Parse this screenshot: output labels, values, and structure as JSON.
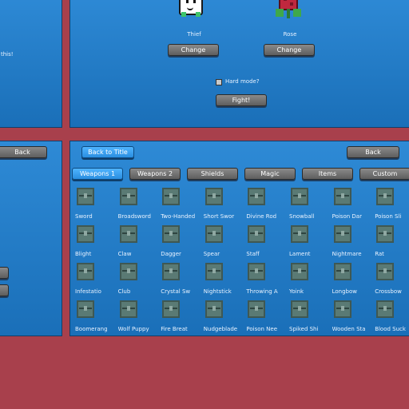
{
  "top_left_panel": {
    "text": "this!"
  },
  "character_select": {
    "characters": [
      {
        "name": "Thief",
        "change_label": "Change"
      },
      {
        "name": "Rose",
        "change_label": "Change"
      }
    ],
    "hard_mode_label": "Hard mode?",
    "hard_mode_checked": false,
    "fight_label": "Fight!"
  },
  "left_panel": {
    "back_label": "Back"
  },
  "item_browser": {
    "back_to_title_label": "Back to Title",
    "back_label": "Back",
    "tabs": [
      {
        "label": "Weapons 1",
        "active": true
      },
      {
        "label": "Weapons 2",
        "active": false
      },
      {
        "label": "Shields",
        "active": false
      },
      {
        "label": "Magic",
        "active": false
      },
      {
        "label": "Items",
        "active": false
      },
      {
        "label": "Custom",
        "active": false
      }
    ],
    "items": [
      "Sword",
      "Broadsword",
      "Two-Handed",
      "Short Swor",
      "Divine Rod",
      "Snowball",
      "Poison Dar",
      "Poison Sli",
      "Blight",
      "Claw",
      "Dagger",
      "Spear",
      "Staff",
      "Lament",
      "Nightmare",
      "Rat",
      "Infestatio",
      "Club",
      "Crystal Sw",
      "Nightstick",
      "Throwing A",
      "Yoink",
      "Longbow",
      "Crossbow",
      "Boomerang",
      "Wolf Puppy",
      "Fire Breat",
      "Nudgeblade",
      "Poison Nee",
      "Spiked Shi",
      "Wooden Sta",
      "Blood Suck"
    ]
  }
}
